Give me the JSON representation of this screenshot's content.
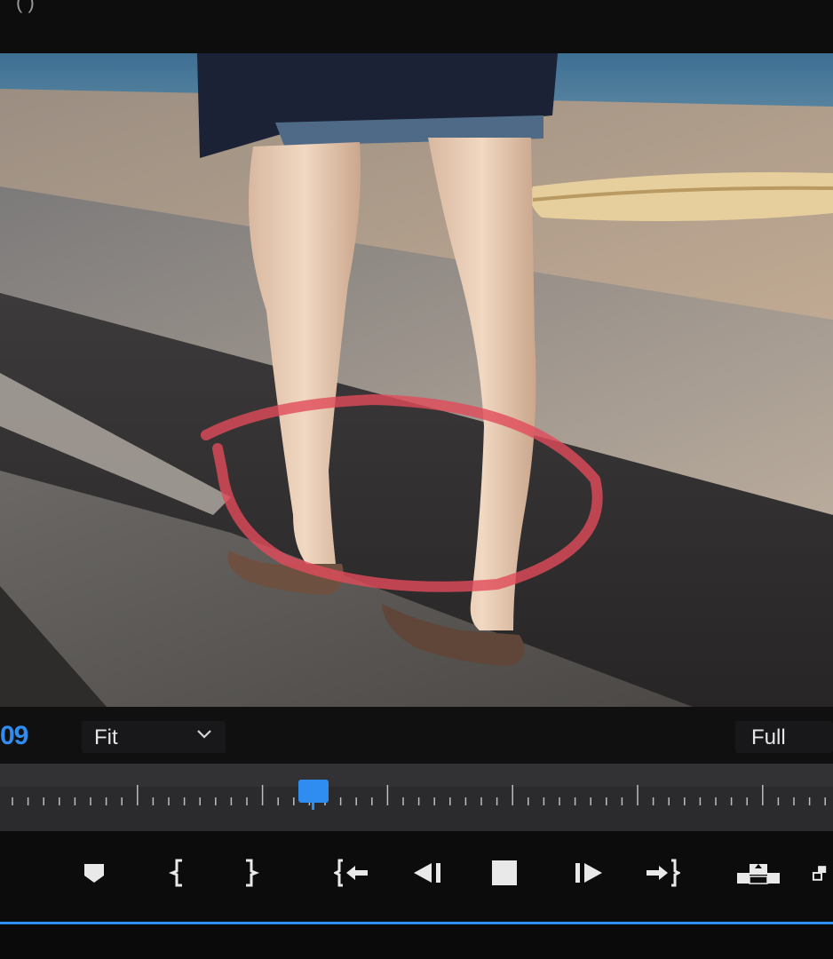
{
  "program_monitor": {
    "timecode": "09",
    "zoom_select": {
      "value": "Fit"
    },
    "resolution_select": {
      "value": "Full"
    }
  },
  "video_frame": {
    "description_icon": "video-preview",
    "annotation_color": "#e14b5a"
  },
  "ruler": {
    "playhead_icon": "playhead-marker"
  },
  "transport": {
    "buttons": [
      {
        "name": "add-marker",
        "icon": "marker-icon"
      },
      {
        "name": "mark-in",
        "icon": "mark-in-icon"
      },
      {
        "name": "mark-out",
        "icon": "mark-out-icon"
      },
      {
        "name": "go-to-in",
        "icon": "go-to-in-icon"
      },
      {
        "name": "step-back",
        "icon": "step-back-icon"
      },
      {
        "name": "stop",
        "icon": "stop-icon"
      },
      {
        "name": "step-forward",
        "icon": "step-forward-icon"
      },
      {
        "name": "go-to-out",
        "icon": "go-to-out-icon"
      },
      {
        "name": "lift",
        "icon": "lift-icon"
      },
      {
        "name": "extract",
        "icon": "extract-icon"
      }
    ]
  },
  "colors": {
    "accent": "#2f8cf0",
    "panel_bg": "#0b0b0c",
    "text": "#e6e6e6"
  }
}
